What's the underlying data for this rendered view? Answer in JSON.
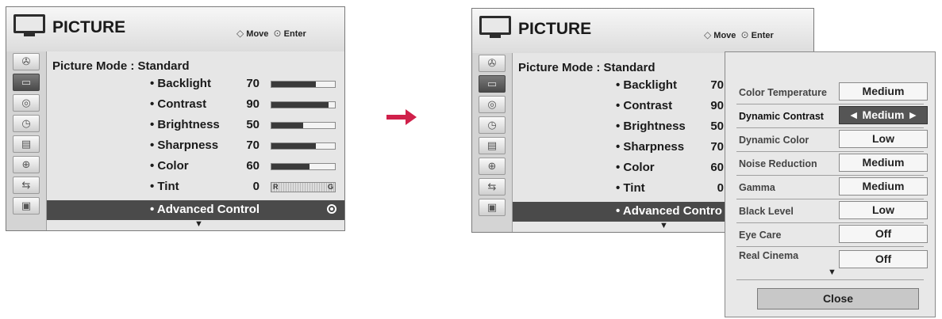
{
  "left": {
    "title": "PICTURE",
    "hint_move": "Move",
    "hint_enter": "Enter",
    "picture_mode": "Picture Mode  : Standard",
    "items": [
      {
        "label": "• Backlight",
        "value": "70",
        "level": 70
      },
      {
        "label": "• Contrast",
        "value": "90",
        "level": 90
      },
      {
        "label": "• Brightness",
        "value": "50",
        "level": 50
      },
      {
        "label": "• Sharpness",
        "value": "70",
        "level": 70
      },
      {
        "label": "• Color",
        "value": "60",
        "level": 60
      },
      {
        "label": "• Tint",
        "value": "0",
        "tint_r": "R",
        "tint_g": "G"
      }
    ],
    "advanced": "• Advanced Control"
  },
  "right": {
    "title": "PICTURE",
    "hint_move": "Move",
    "hint_enter": "Enter",
    "picture_mode": "Picture Mode  : Standard",
    "items": [
      {
        "label": "• Backlight",
        "value": "70"
      },
      {
        "label": "• Contrast",
        "value": "90"
      },
      {
        "label": "• Brightness",
        "value": "50"
      },
      {
        "label": "• Sharpness",
        "value": "70"
      },
      {
        "label": "• Color",
        "value": "60"
      },
      {
        "label": "• Tint",
        "value": "0"
      }
    ],
    "advanced": "• Advanced Contro"
  },
  "popup": {
    "rows": [
      {
        "label": "Color Temperature",
        "value": "Medium"
      },
      {
        "label": "Dynamic Contrast",
        "value": "◄  Medium  ►"
      },
      {
        "label": "Dynamic Color",
        "value": "Low"
      },
      {
        "label": "Noise Reduction",
        "value": "Medium"
      },
      {
        "label": "Gamma",
        "value": "Medium"
      },
      {
        "label": "Black Level",
        "value": "Low"
      },
      {
        "label": "Eye Care",
        "value": "Off"
      },
      {
        "label": "Real Cinema",
        "value": "Off"
      }
    ],
    "close": "Close"
  },
  "icons": [
    "tv-icon",
    "satellite-icon",
    "picture-icon",
    "audio-icon",
    "clock-icon",
    "option-icon",
    "lock-icon",
    "input-icon",
    "usb-photo-icon"
  ],
  "colors": {
    "arrow": "#d0204a",
    "selected": "#4a4a4a"
  }
}
